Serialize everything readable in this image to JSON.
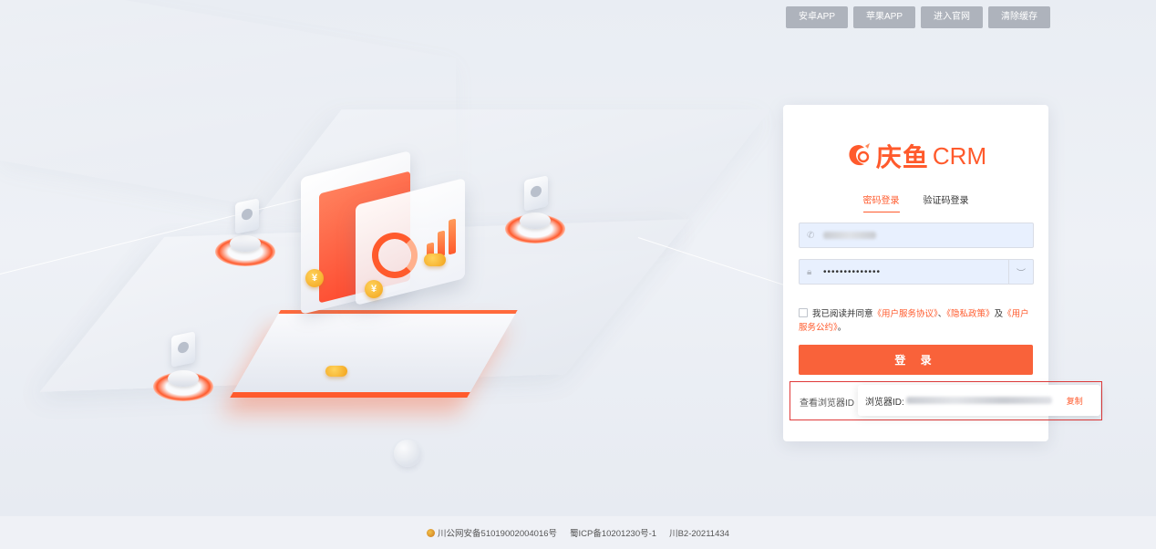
{
  "top_buttons": {
    "android": "安卓APP",
    "apple": "苹果APP",
    "official": "进入官网",
    "clear_cache": "清除缓存"
  },
  "brand": {
    "name_cn": "庆鱼",
    "name_en": "CRM",
    "accent": "#ff5a2c"
  },
  "tabs": {
    "password": "密码登录",
    "code": "验证码登录"
  },
  "form": {
    "password_mask": "••••••••••••••"
  },
  "agreement": {
    "prefix": "我已阅读并同意",
    "user_agreement": "《用户服务协议》",
    "separator": "、",
    "privacy": "《隐私政策》",
    "and": "及",
    "convention": "《用户服务公约》",
    "suffix": "。"
  },
  "login_button": "登 录",
  "browser_id": {
    "label": "查看浏览器ID",
    "prefix": "浏览器ID:",
    "copy": "复制"
  },
  "footer": {
    "police": "川公网安备51019002004016号",
    "icp": "蜀ICP备10201230号-1",
    "license": "川B2-20211434"
  }
}
